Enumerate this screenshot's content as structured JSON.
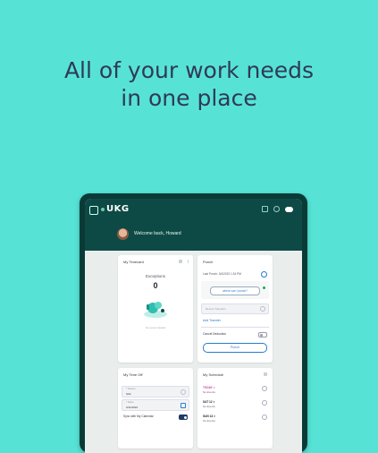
{
  "headline": {
    "line1": "All of your work needs",
    "line2": "in one place"
  },
  "app": {
    "brand": "UKG",
    "welcome": "Welcome back, Howard"
  },
  "my_timecard": {
    "title": "My Timecard",
    "exceptions_label": "Exceptions",
    "exceptions_count": "0",
    "empty_text": "No recent details"
  },
  "punch": {
    "title": "Punch",
    "last_punch": "Last Punch: 3/4/2022 1:34 PM",
    "location_link": "where can I punch?",
    "transfer_placeholder": "Recent Transfers",
    "add_transfer": "Add Transfer",
    "cancel_deduction": "Cancel Deduction",
    "punch_button": "Punch"
  },
  "my_time_off": {
    "title": "My Time Off",
    "type_label": "* Reason",
    "type_value": "Sick",
    "date_label": "* Dates",
    "date_value": "3/11/2022",
    "sync_label": "Sync with My Calendar"
  },
  "my_schedule": {
    "title": "My Schedule",
    "rows": [
      {
        "day": "TODAY >",
        "detail": "No Events",
        "color": "#d43ea3"
      },
      {
        "day": "SAT 12 >",
        "detail": "No Events",
        "color": "#223"
      },
      {
        "day": "SUN 13 >",
        "detail": "No Events",
        "color": "#223"
      }
    ]
  },
  "colors": {
    "background": "#56e3d6",
    "header": "#0d4a45",
    "accent": "#2a7bd1"
  }
}
